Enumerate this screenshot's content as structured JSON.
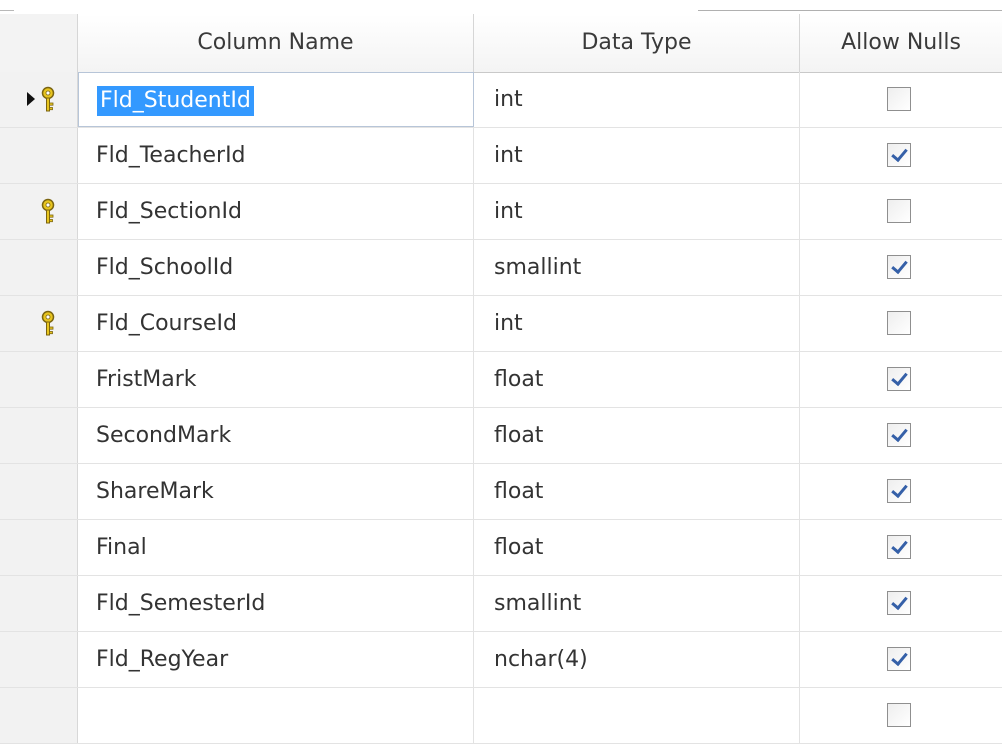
{
  "header": {
    "column_name": "Column Name",
    "data_type": "Data Type",
    "allow_nulls": "Allow Nulls"
  },
  "rows": [
    {
      "name": "Fld_StudentId",
      "type": "int",
      "allow_nulls": false,
      "primary_key": true,
      "current": true,
      "selected": true
    },
    {
      "name": "Fld_TeacherId",
      "type": "int",
      "allow_nulls": true,
      "primary_key": false,
      "current": false,
      "selected": false
    },
    {
      "name": "Fld_SectionId",
      "type": "int",
      "allow_nulls": false,
      "primary_key": true,
      "current": false,
      "selected": false
    },
    {
      "name": "Fld_SchoolId",
      "type": "smallint",
      "allow_nulls": true,
      "primary_key": false,
      "current": false,
      "selected": false
    },
    {
      "name": "Fld_CourseId",
      "type": "int",
      "allow_nulls": false,
      "primary_key": true,
      "current": false,
      "selected": false
    },
    {
      "name": "FristMark",
      "type": "float",
      "allow_nulls": true,
      "primary_key": false,
      "current": false,
      "selected": false
    },
    {
      "name": "SecondMark",
      "type": "float",
      "allow_nulls": true,
      "primary_key": false,
      "current": false,
      "selected": false
    },
    {
      "name": "ShareMark",
      "type": "float",
      "allow_nulls": true,
      "primary_key": false,
      "current": false,
      "selected": false
    },
    {
      "name": "Final",
      "type": "float",
      "allow_nulls": true,
      "primary_key": false,
      "current": false,
      "selected": false
    },
    {
      "name": "Fld_SemesterId",
      "type": "smallint",
      "allow_nulls": true,
      "primary_key": false,
      "current": false,
      "selected": false
    },
    {
      "name": "Fld_RegYear",
      "type": "nchar(4)",
      "allow_nulls": true,
      "primary_key": false,
      "current": false,
      "selected": false
    },
    {
      "name": "",
      "type": "",
      "allow_nulls": false,
      "primary_key": false,
      "current": false,
      "selected": false
    }
  ],
  "colors": {
    "selection": "#3399ff",
    "key": "#e8c51f",
    "check": "#3560a8"
  }
}
